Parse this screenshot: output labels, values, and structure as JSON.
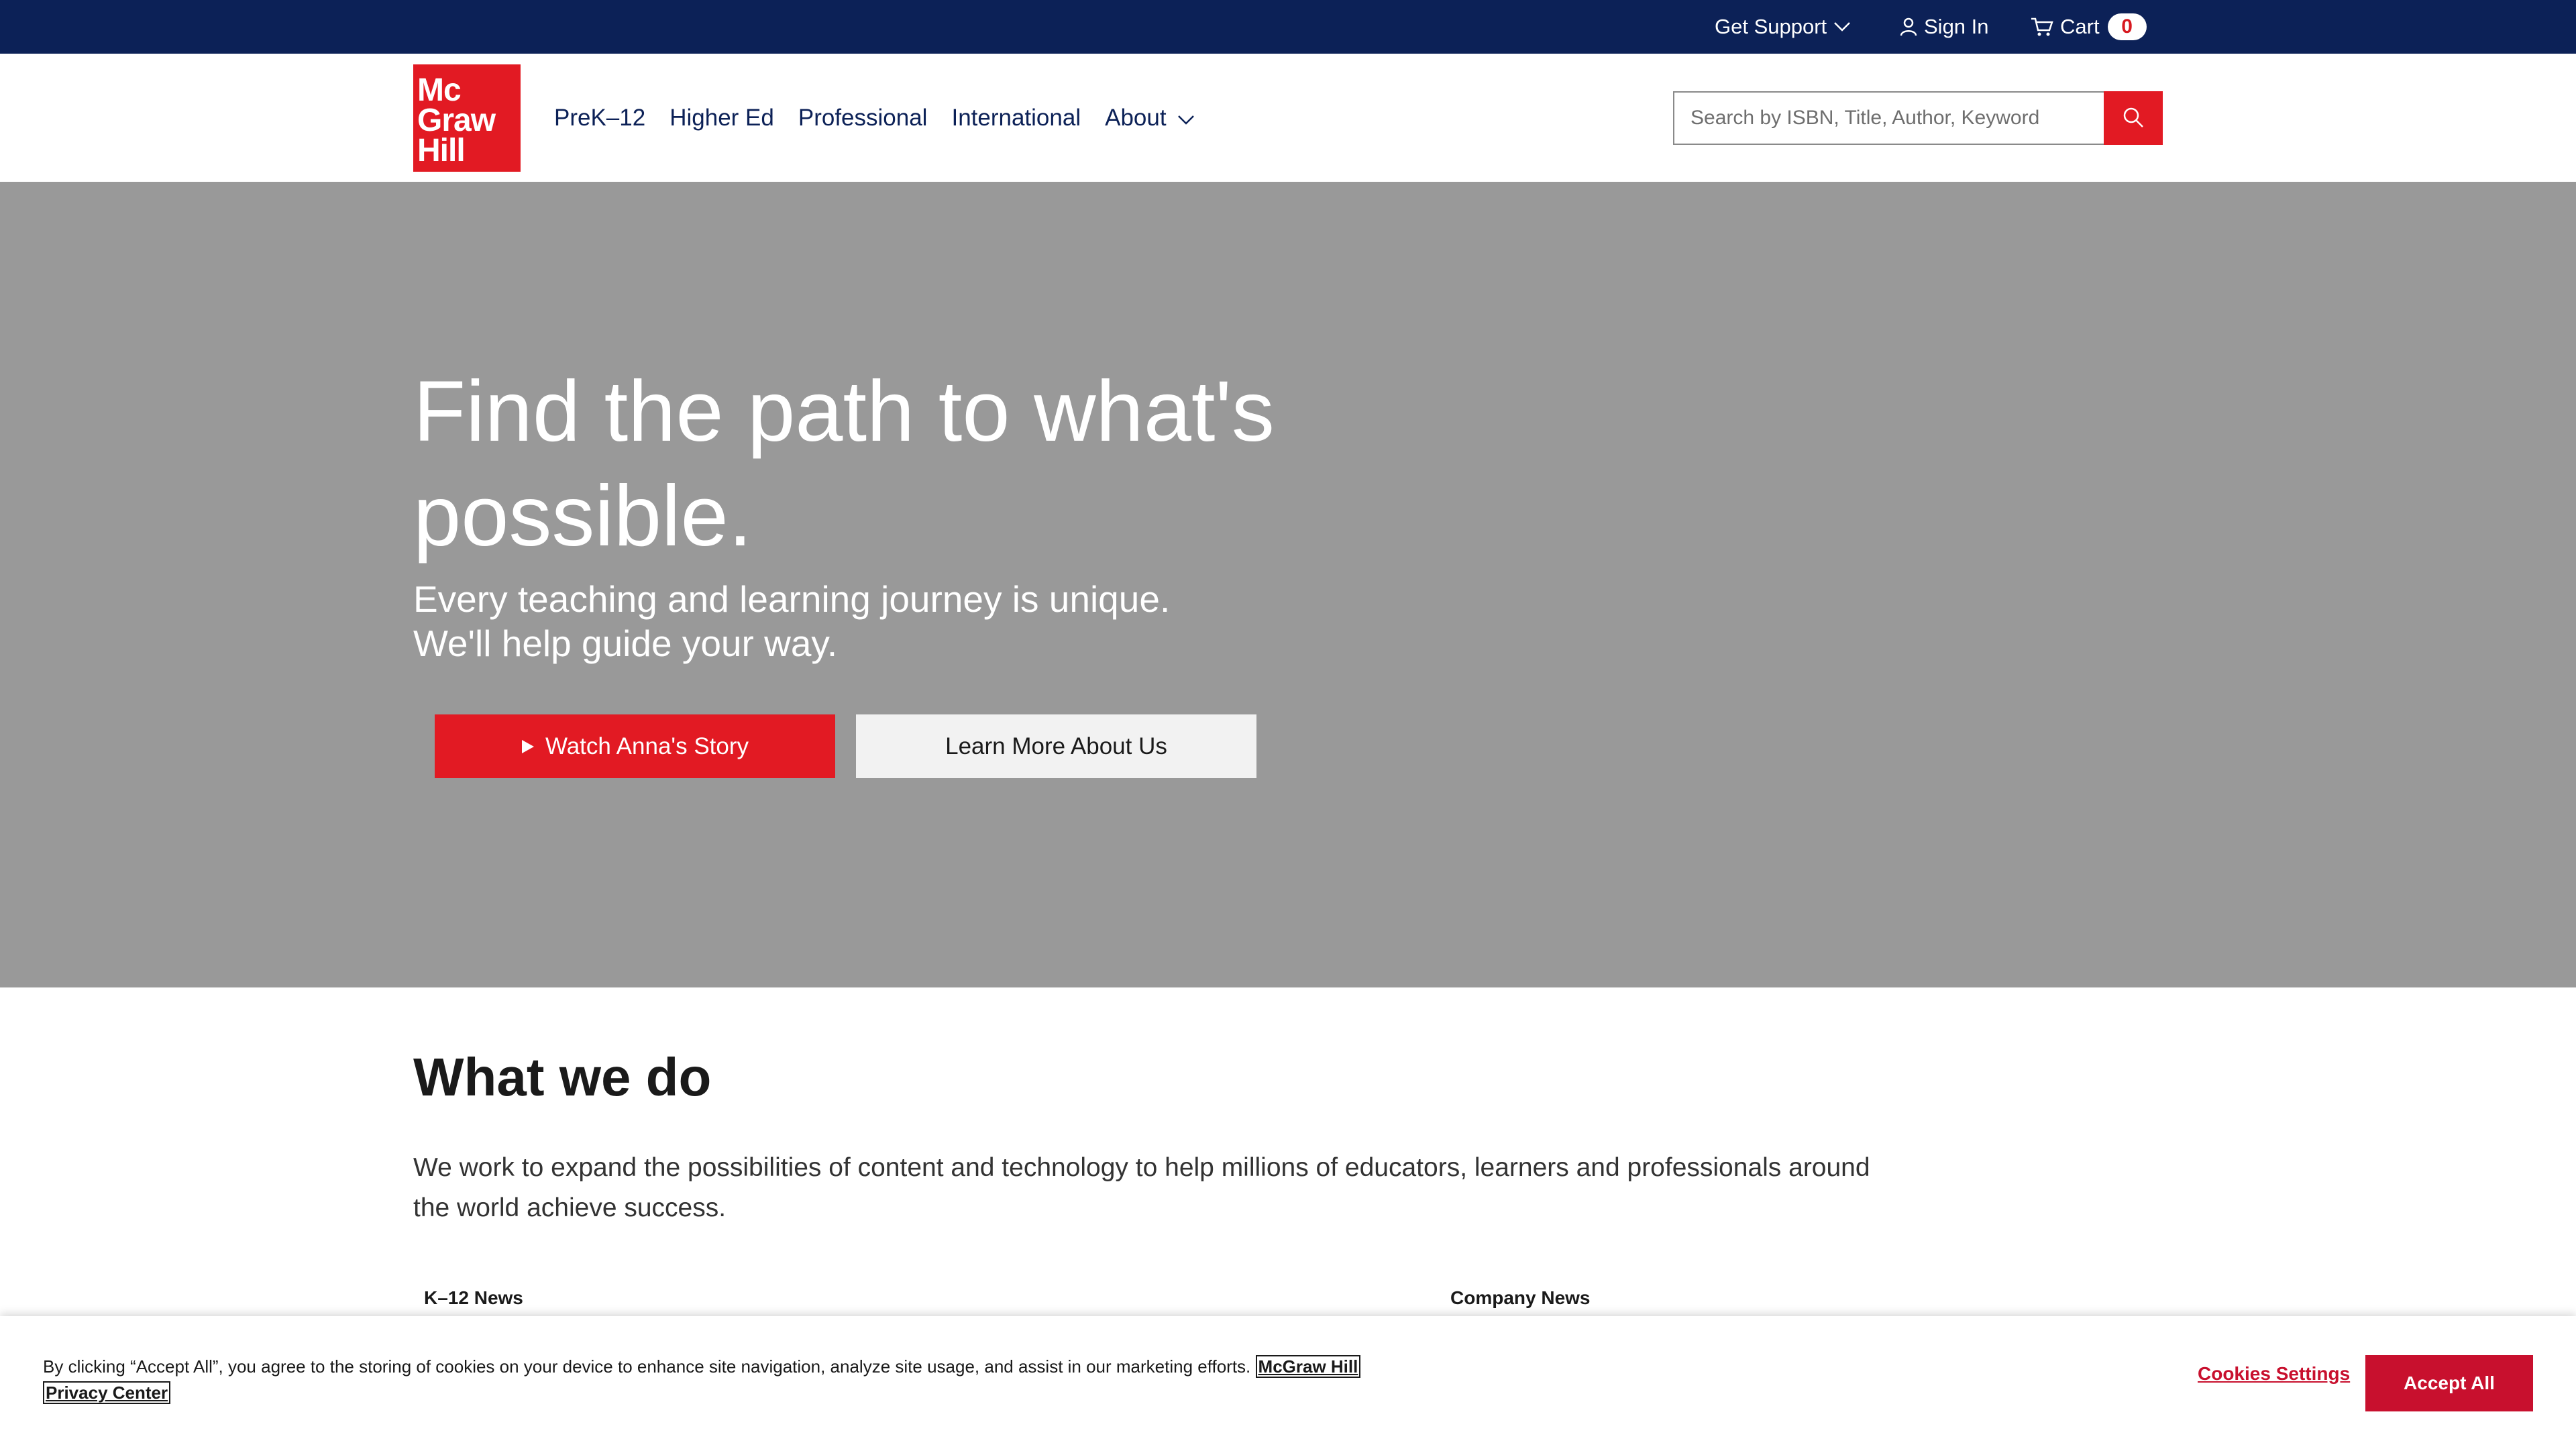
{
  "utility_bar": {
    "get_support": "Get Support",
    "sign_in": "Sign In",
    "cart_label": "Cart",
    "cart_count": "0"
  },
  "header": {
    "logo_lines": [
      "Mc",
      "Graw",
      "Hill"
    ],
    "nav": [
      "PreK–12",
      "Higher Ed",
      "Professional",
      "International",
      "About"
    ],
    "search_placeholder": "Search by ISBN, Title, Author, Keyword"
  },
  "hero": {
    "title": "Find the path to what's possible.",
    "subtitle_lines": [
      "Every teaching and learning journey is unique.",
      "We'll help guide your way."
    ],
    "primary_button": "Watch Anna's Story",
    "secondary_button": "Learn More About Us"
  },
  "what_we_do": {
    "title": "What we do",
    "text": "We work to expand the possibilities of content and technology to help millions of educators, learners and professionals around the world achieve success.",
    "news_labels": [
      "K–12 News",
      "Company News"
    ]
  },
  "cookie_banner": {
    "text": "By clicking “Accept All”, you agree to the storing of cookies on your device to enhance site navigation, analyze site usage, and assist in our marketing efforts.",
    "link_1": "McGraw Hill",
    "link_2": "Privacy Center",
    "settings": "Cookies Settings",
    "accept": "Accept All"
  },
  "colors": {
    "navy": "#0c2157",
    "brand_red": "#e21a23",
    "hero_gray": "#999999",
    "cookie_red": "#c8102e"
  },
  "icons": [
    "chevron-down-icon",
    "user-icon",
    "cart-icon",
    "search-icon",
    "play-icon"
  ]
}
